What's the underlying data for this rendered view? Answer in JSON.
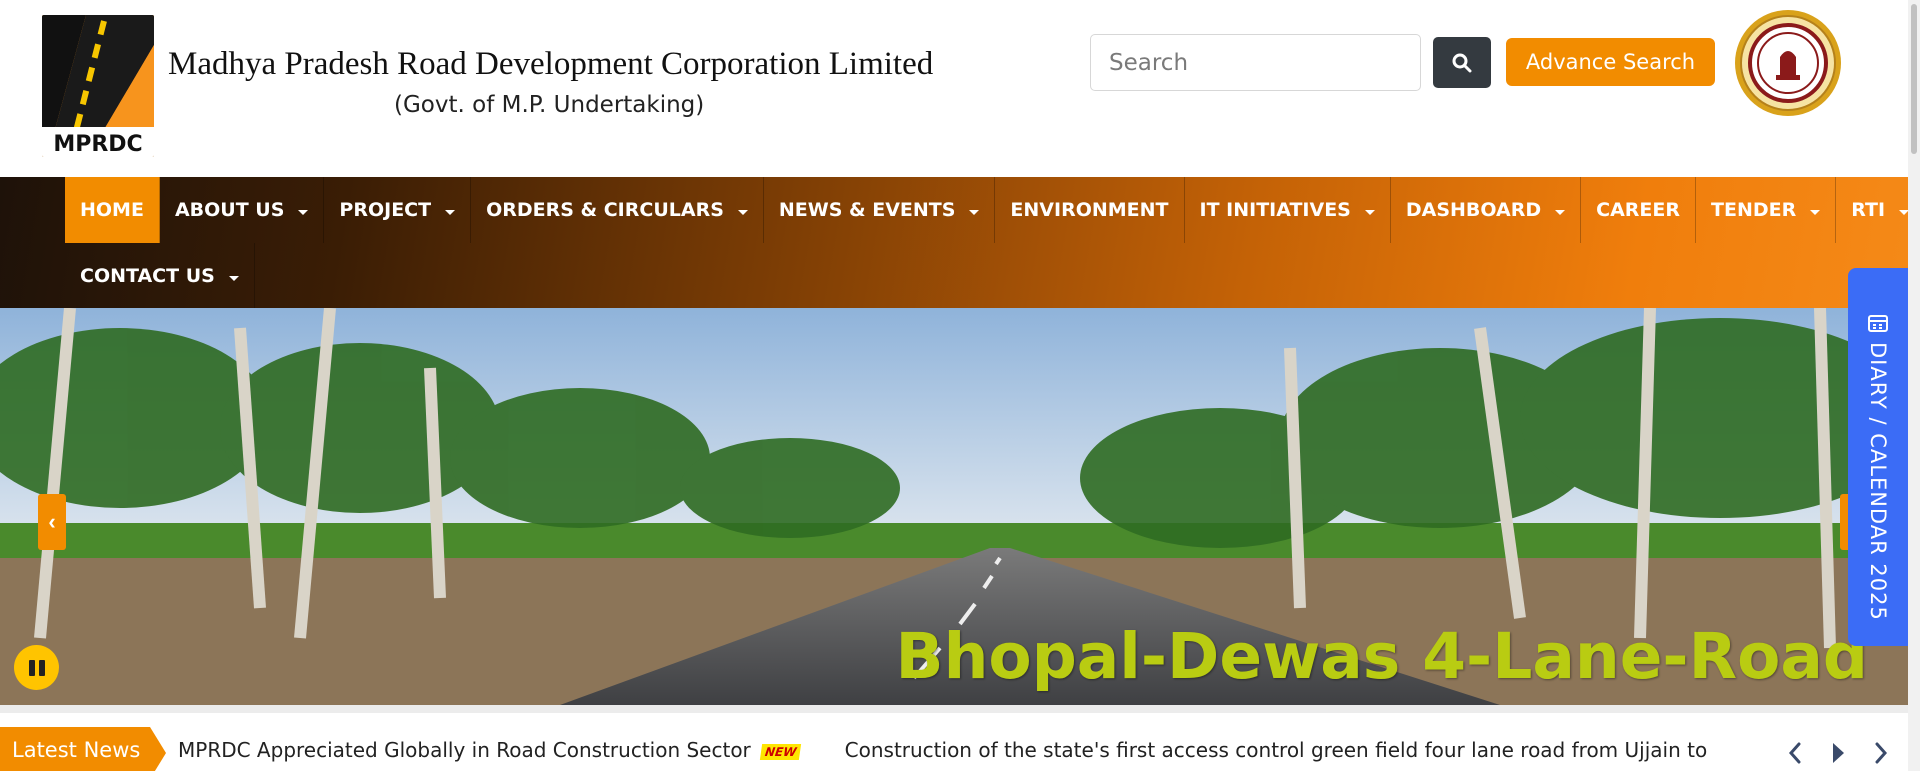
{
  "header": {
    "logo_text": "MPRDC",
    "title": "Madhya Pradesh Road Development Corporation Limited",
    "subtitle": "(Govt. of M.P. Undertaking)",
    "search_placeholder": "Search",
    "search_icon": "search-icon",
    "advance_search_label": "Advance Search",
    "emblem": "mp-government-emblem"
  },
  "nav": {
    "items": [
      {
        "label": "HOME",
        "dropdown": false,
        "active": true
      },
      {
        "label": "ABOUT US",
        "dropdown": true
      },
      {
        "label": "PROJECT",
        "dropdown": true
      },
      {
        "label": "ORDERS & CIRCULARS",
        "dropdown": true
      },
      {
        "label": "NEWS & EVENTS",
        "dropdown": true
      },
      {
        "label": "ENVIRONMENT",
        "dropdown": false
      },
      {
        "label": "IT INITIATIVES",
        "dropdown": true
      },
      {
        "label": "DASHBOARD",
        "dropdown": true
      },
      {
        "label": "CAREER",
        "dropdown": false
      },
      {
        "label": "TENDER",
        "dropdown": true
      },
      {
        "label": "RTI",
        "dropdown": true
      },
      {
        "label": "CONTACT US",
        "dropdown": true
      }
    ]
  },
  "slider": {
    "caption": "Bhopal-Dewas 4-Lane-Road",
    "prev_label": "‹",
    "caption_color": "#b9cc12"
  },
  "diary": {
    "label": "DIARY / CALENDAR 2025",
    "icon": "calendar-icon"
  },
  "news": {
    "label": "Latest News",
    "items": [
      {
        "text": "MPRDC Appreciated Globally in Road Construction Sector",
        "badge": "NEW"
      },
      {
        "text": "Construction of the state's first access control green field four lane road from Ujjain to"
      }
    ]
  },
  "colors": {
    "accent": "#f28c00",
    "diary": "#3b6cf6",
    "dark_button": "#343a40"
  }
}
